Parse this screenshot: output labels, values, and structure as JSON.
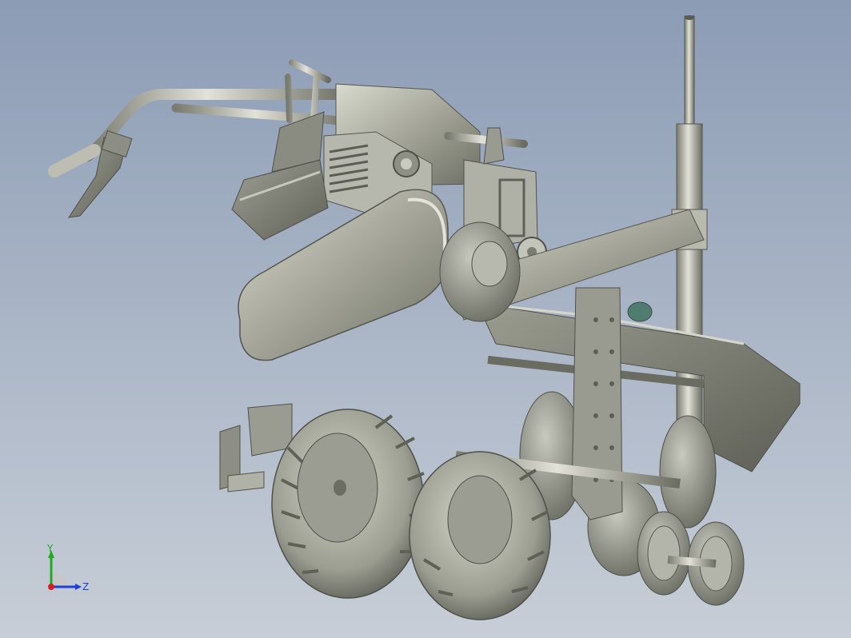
{
  "viewport": {
    "background_top": "#8c9cb5",
    "background_bottom": "#c7ced7",
    "model_color": "#a7a89b",
    "model_shadow": "#6f7065",
    "model_highlight": "#dcdcd2"
  },
  "triad": {
    "y_label": "Y",
    "z_label": "Z",
    "y_color": "#22aa22",
    "z_color": "#1f3fd6",
    "x_color": "#d42020"
  }
}
